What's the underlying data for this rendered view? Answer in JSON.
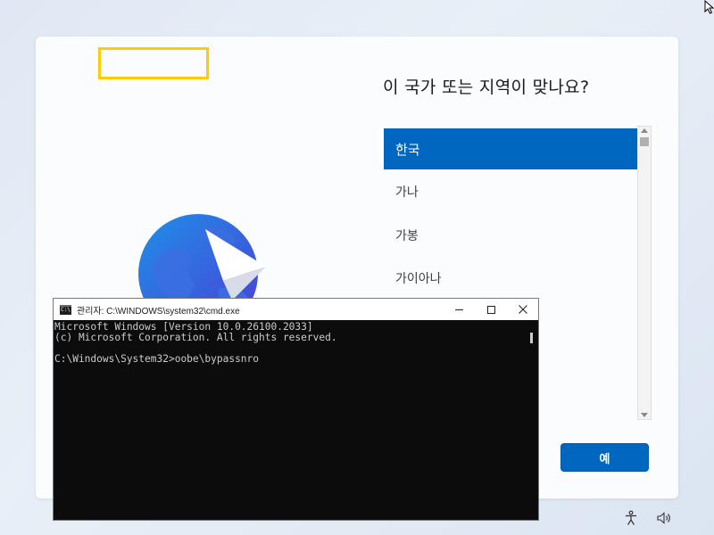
{
  "oobe": {
    "title": "이 국가 또는 지역이 맞나요?",
    "countries": [
      {
        "label": "한국",
        "selected": true
      },
      {
        "label": "가나",
        "selected": false
      },
      {
        "label": "가봉",
        "selected": false
      },
      {
        "label": "가이아나",
        "selected": false
      }
    ],
    "yes_label": "예"
  },
  "cmd": {
    "title": "관리자: C:\\WINDOWS\\system32\\cmd.exe",
    "app_icon_text": "C:\\",
    "lines": [
      "Microsoft Windows [Version 10.0.26100.2033]",
      "(c) Microsoft Corporation. All rights reserved.",
      "",
      "C:\\Windows\\System32>oobe\\bypassnro"
    ]
  },
  "colors": {
    "accent": "#0067c0",
    "highlight": "#ffcc00",
    "console_bg": "#0c0c0c",
    "console_text": "#cccccc"
  },
  "icons": [
    "globe-icon",
    "paper-plane-icon",
    "accessibility-icon",
    "volume-icon",
    "mouse-cursor-icon"
  ]
}
